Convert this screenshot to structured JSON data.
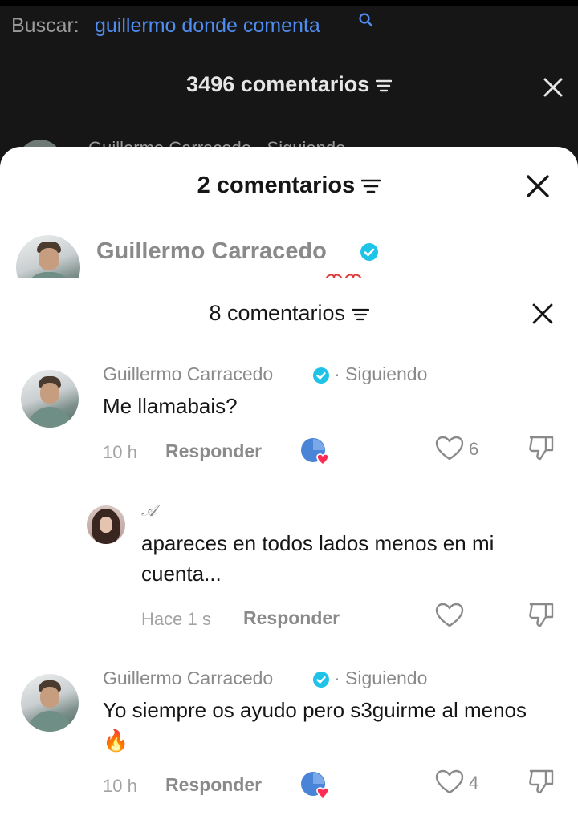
{
  "search": {
    "label": "Buscar:",
    "query": "guillermo donde comenta"
  },
  "background": {
    "title": "3496 comentarios",
    "peek_text": "Guillermo Carracedo · Siguiendo"
  },
  "sheet2": {
    "title": "2 comentarios",
    "author": "Guillermo Carracedo"
  },
  "sheet3": {
    "title": "8 comentarios",
    "comments": [
      {
        "author": "Guillermo Carracedo",
        "following": "· Siguiendo",
        "text": "Me llamabais?",
        "time": "10 h",
        "reply": "Responder",
        "likes": "6"
      },
      {
        "author": "𝒜",
        "text": "apareces en todos lados menos en mi cuenta...",
        "time": "Hace 1 s",
        "reply": "Responder"
      },
      {
        "author": "Guillermo Carracedo",
        "following": "· Siguiendo",
        "text": "Yo siempre os ayudo pero s3guirme al menos 🔥",
        "time": "10 h",
        "reply": "Responder",
        "likes": "4"
      }
    ]
  },
  "colors": {
    "background": "#161616",
    "search_query": "#4f8df1",
    "verified": "#20c3e8",
    "secondary_text": "#8a8a8a",
    "like_heart": "#fe2c55"
  },
  "icons": [
    "search-icon",
    "filter-icon",
    "close-icon",
    "verified-icon",
    "heart-icon",
    "dislike-icon",
    "creator-liked-icon"
  ]
}
